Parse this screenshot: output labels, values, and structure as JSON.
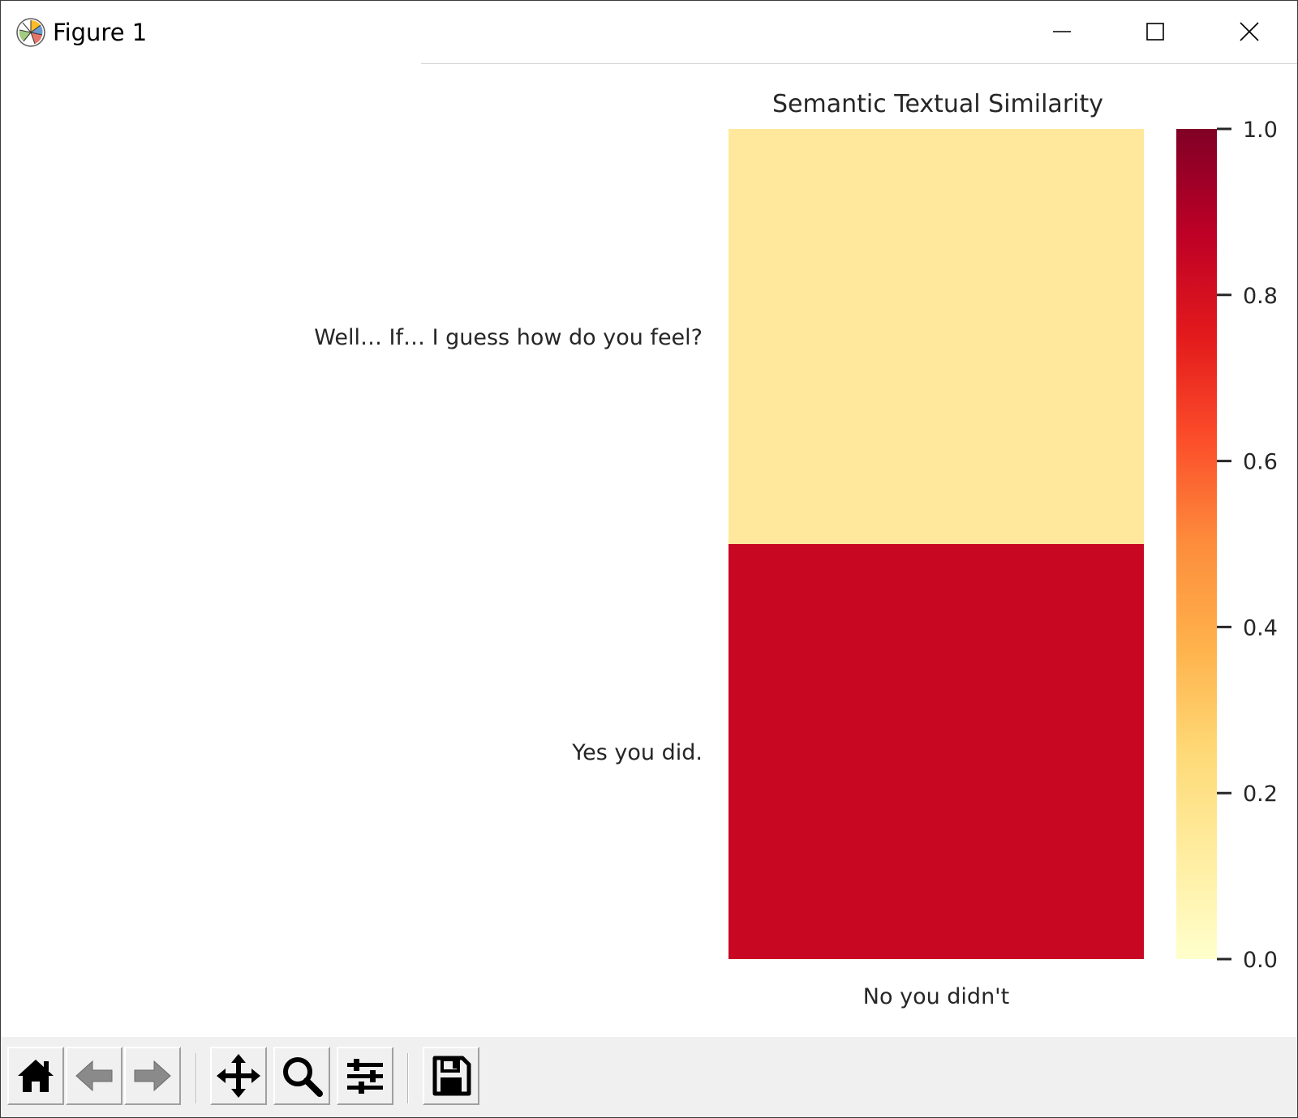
{
  "window": {
    "title": "Figure 1",
    "icons": {
      "app": "matplotlib-logo-icon",
      "minimize": "minimize-icon",
      "maximize": "maximize-icon",
      "close": "close-icon"
    }
  },
  "chart_data": {
    "type": "heatmap",
    "title": "Semantic Textual Similarity",
    "x_categories": [
      "No you didn't"
    ],
    "y_categories": [
      "Well… If… I guess how do you feel?",
      "Yes you did."
    ],
    "values": [
      [
        0.1
      ],
      [
        0.88
      ]
    ],
    "colormap": "YlOrRd",
    "colorbar": {
      "range": [
        0.0,
        1.0
      ],
      "ticks": [
        "0.0",
        "0.2",
        "0.4",
        "0.6",
        "0.8",
        "1.0"
      ],
      "tick_values": [
        0.0,
        0.2,
        0.4,
        0.6,
        0.8,
        1.0
      ]
    },
    "cell_colors": [
      "#ffe89c",
      "#c80822"
    ],
    "grid": false
  },
  "toolbar": {
    "buttons": [
      {
        "name": "home-button",
        "icon": "home-icon"
      },
      {
        "name": "back-button",
        "icon": "arrow-left-icon"
      },
      {
        "name": "forward-button",
        "icon": "arrow-right-icon"
      },
      {
        "name": "pan-button",
        "icon": "move-icon"
      },
      {
        "name": "zoom-button",
        "icon": "magnifier-icon"
      },
      {
        "name": "configure-subplots-button",
        "icon": "sliders-icon"
      },
      {
        "name": "save-button",
        "icon": "floppy-disk-icon"
      }
    ]
  }
}
